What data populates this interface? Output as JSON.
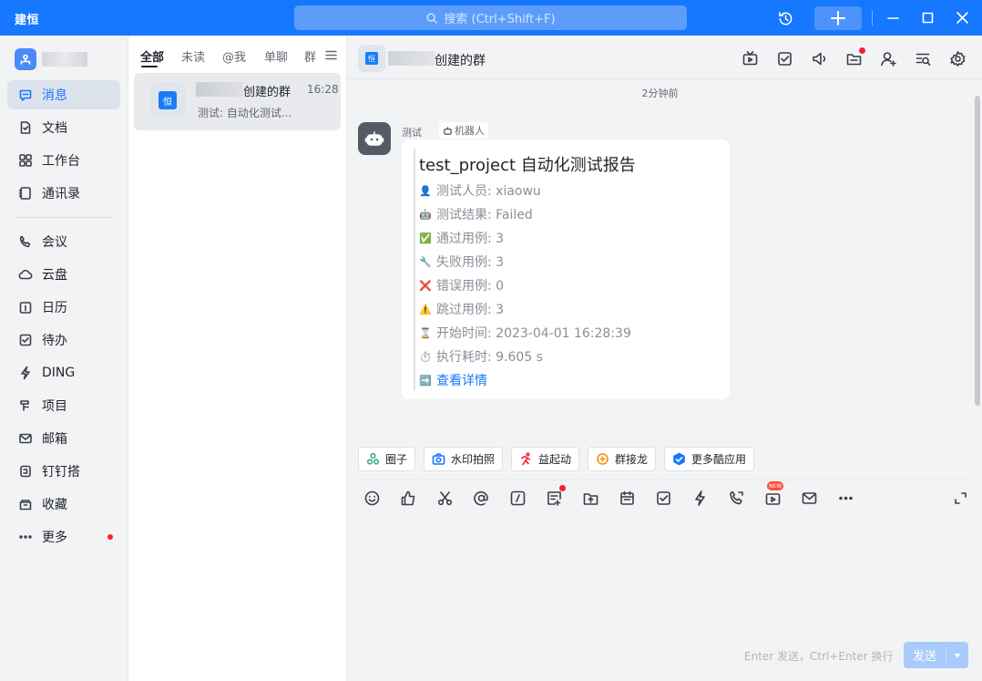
{
  "app": {
    "title": "建恒"
  },
  "search": {
    "placeholder": "搜索 (Ctrl+Shift+F)"
  },
  "nav": {
    "items": [
      {
        "label": "消息",
        "icon": "message-icon"
      },
      {
        "label": "文档",
        "icon": "document-icon"
      },
      {
        "label": "工作台",
        "icon": "workbench-icon"
      },
      {
        "label": "通讯录",
        "icon": "contacts-icon"
      },
      {
        "label": "会议",
        "icon": "meeting-icon"
      },
      {
        "label": "云盘",
        "icon": "cloud-icon"
      },
      {
        "label": "日历",
        "icon": "calendar-icon"
      },
      {
        "label": "待办",
        "icon": "todo-icon"
      },
      {
        "label": "DING",
        "icon": "ding-icon"
      },
      {
        "label": "项目",
        "icon": "project-icon"
      },
      {
        "label": "邮箱",
        "icon": "mail-icon"
      },
      {
        "label": "钉钉搭",
        "icon": "builder-icon"
      },
      {
        "label": "收藏",
        "icon": "favorites-icon"
      },
      {
        "label": "更多",
        "icon": "more-icon"
      }
    ]
  },
  "conversations": {
    "tabs": [
      "全部",
      "未读",
      "@我",
      "单聊",
      "群"
    ],
    "items": [
      {
        "avatar_text": "恒",
        "name": "创建的群",
        "time": "16:28",
        "preview": "测试: 自动化测试..."
      }
    ]
  },
  "chat": {
    "title": "创建的群",
    "avatar_text": "恒",
    "timestamp": "2分钟前",
    "message": {
      "sender": "测试",
      "sender_tag": "机器人",
      "title": "test_project 自动化测试报告",
      "fields": [
        {
          "emoji": "👤",
          "text": "测试人员: xiaowu"
        },
        {
          "emoji": "🤖",
          "text": "测试结果: Failed"
        },
        {
          "emoji": "✅",
          "text": "通过用例: 3"
        },
        {
          "emoji": "🔧",
          "text": "失败用例: 3"
        },
        {
          "emoji": "❌",
          "text": "错误用例: 0"
        },
        {
          "emoji": "⚠️",
          "text": "跳过用例: 3"
        },
        {
          "emoji": "⌛",
          "text": "开始时间: 2023-04-01 16:28:39"
        },
        {
          "emoji": "⏱️",
          "text": "执行耗时: 9.605 s"
        }
      ],
      "link": {
        "emoji": "➡️",
        "text": "查看详情"
      }
    },
    "quick_apps": [
      "圈子",
      "水印拍照",
      "益起动",
      "群接龙",
      "更多酷应用"
    ],
    "new_badge": "NEW",
    "send_hint": "Enter 发送，Ctrl+Enter 换行",
    "send_label": "发送"
  },
  "colors": {
    "brand": "#1677ff",
    "badge_red": "#f5222d"
  }
}
